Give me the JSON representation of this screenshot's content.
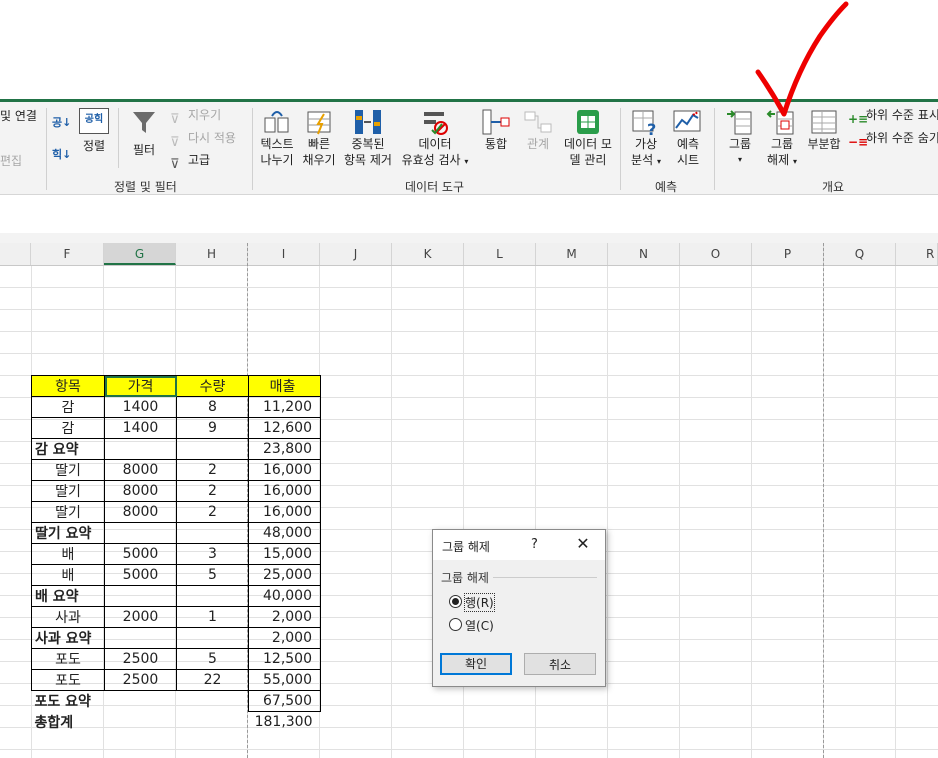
{
  "ribbon": {
    "left_partial": {
      "connections": "및 연결",
      "edit_links": "편집"
    },
    "sort": {
      "asc_icon_text": "공↓",
      "desc_icon_text": "힉↓",
      "sort_label": "정렬",
      "sort_icon_text": "공힉"
    },
    "filter": {
      "label": "필터",
      "clear": "지우기",
      "reapply": "다시 적용",
      "advanced": "고급"
    },
    "sort_filter_group": "정렬 및 필터",
    "data_tools": {
      "text_to_columns": [
        "텍스트",
        "나누기"
      ],
      "flash_fill": [
        "빠른",
        "채우기"
      ],
      "remove_duplicates": [
        "중복된",
        "항목 제거"
      ],
      "data_validation": [
        "데이터",
        "유효성 검사"
      ],
      "consolidate": "통합",
      "relationships": "관계",
      "data_model": [
        "데이터 모",
        "델 관리"
      ],
      "group": "데이터 도구"
    },
    "forecast": {
      "what_if": [
        "가상",
        "분석"
      ],
      "forecast_sheet": [
        "예측",
        "시트"
      ],
      "group": "예측"
    },
    "outline": {
      "group_btn": "그룹",
      "ungroup_btn": [
        "그룹",
        "해제"
      ],
      "subtotal": "부분합",
      "show_detail": "하위 수준 표시",
      "hide_detail": "하위 수준 숨기기",
      "group": "개요"
    }
  },
  "columns": [
    "F",
    "G",
    "H",
    "I",
    "J",
    "K",
    "L",
    "M",
    "N",
    "O",
    "P",
    "Q",
    "R"
  ],
  "table": {
    "headers": [
      "항목",
      "가격",
      "수량",
      "매출"
    ],
    "rows": [
      {
        "type": "data",
        "cells": [
          "감",
          "1400",
          "8",
          "11,200"
        ]
      },
      {
        "type": "data",
        "cells": [
          "감",
          "1400",
          "9",
          "12,600"
        ]
      },
      {
        "type": "sum",
        "cells": [
          "감 요약",
          "",
          "",
          "23,800"
        ]
      },
      {
        "type": "data",
        "cells": [
          "딸기",
          "8000",
          "2",
          "16,000"
        ]
      },
      {
        "type": "data",
        "cells": [
          "딸기",
          "8000",
          "2",
          "16,000"
        ]
      },
      {
        "type": "data",
        "cells": [
          "딸기",
          "8000",
          "2",
          "16,000"
        ]
      },
      {
        "type": "sum",
        "cells": [
          "딸기 요약",
          "",
          "",
          "48,000"
        ]
      },
      {
        "type": "data",
        "cells": [
          "배",
          "5000",
          "3",
          "15,000"
        ]
      },
      {
        "type": "data",
        "cells": [
          "배",
          "5000",
          "5",
          "25,000"
        ]
      },
      {
        "type": "sum",
        "cells": [
          "배 요약",
          "",
          "",
          "40,000"
        ]
      },
      {
        "type": "data",
        "cells": [
          "사과",
          "2000",
          "1",
          "2,000"
        ]
      },
      {
        "type": "sum",
        "cells": [
          "사과  요약",
          "",
          "",
          "2,000"
        ]
      },
      {
        "type": "data",
        "cells": [
          "포도",
          "2500",
          "5",
          "12,500"
        ]
      },
      {
        "type": "data",
        "cells": [
          "포도",
          "2500",
          "22",
          "55,000"
        ]
      },
      {
        "type": "sumlast",
        "cells": [
          "포도 요약",
          "",
          "",
          "67,500"
        ]
      },
      {
        "type": "total",
        "cells": [
          "총합계",
          "",
          "",
          "181,300"
        ]
      }
    ]
  },
  "dialog": {
    "title": "그룹 해제",
    "help": "?",
    "close": "✕",
    "group_label": "그룹 해제",
    "options": [
      {
        "label": "행(R)",
        "selected": true
      },
      {
        "label": "열(C)",
        "selected": false
      }
    ],
    "ok": "확인",
    "cancel": "취소"
  },
  "colors": {
    "accent_green": "#217346",
    "header_fill": "#ffff00",
    "annotation_check": "#ee0000"
  }
}
